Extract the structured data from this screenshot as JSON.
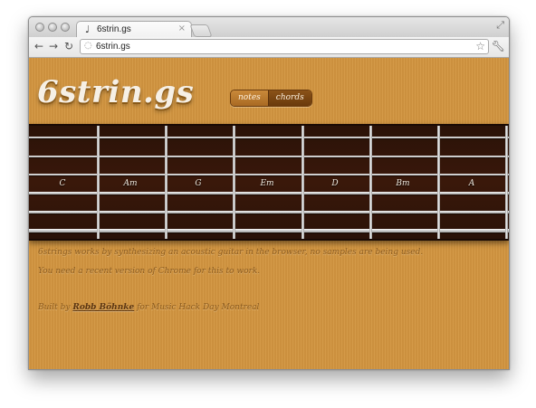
{
  "browser": {
    "tab_title": "6strin.gs",
    "tab_favicon": "guitar-favicon",
    "tab_close": "×",
    "url": "6strin.gs"
  },
  "page": {
    "logo": "6strin.gs",
    "switch": {
      "notes_label": "notes",
      "chords_label": "chords",
      "active": "chords"
    },
    "chords": [
      "C",
      "Am",
      "G",
      "Em",
      "D",
      "Bm",
      "A"
    ],
    "description_line1": "6strings works by synthesizing an acoustic guitar in the browser, no samples are being used.",
    "description_line2": "You need a recent version of Chrome for this to work.",
    "credit_prefix": "Built by ",
    "credit_author": "Robb Böhnke",
    "credit_suffix": " for Music Hack Day Montreal",
    "colors": {
      "background": "#d29540",
      "fretboard": "#3a180a",
      "text": "#8c5b1e"
    }
  }
}
